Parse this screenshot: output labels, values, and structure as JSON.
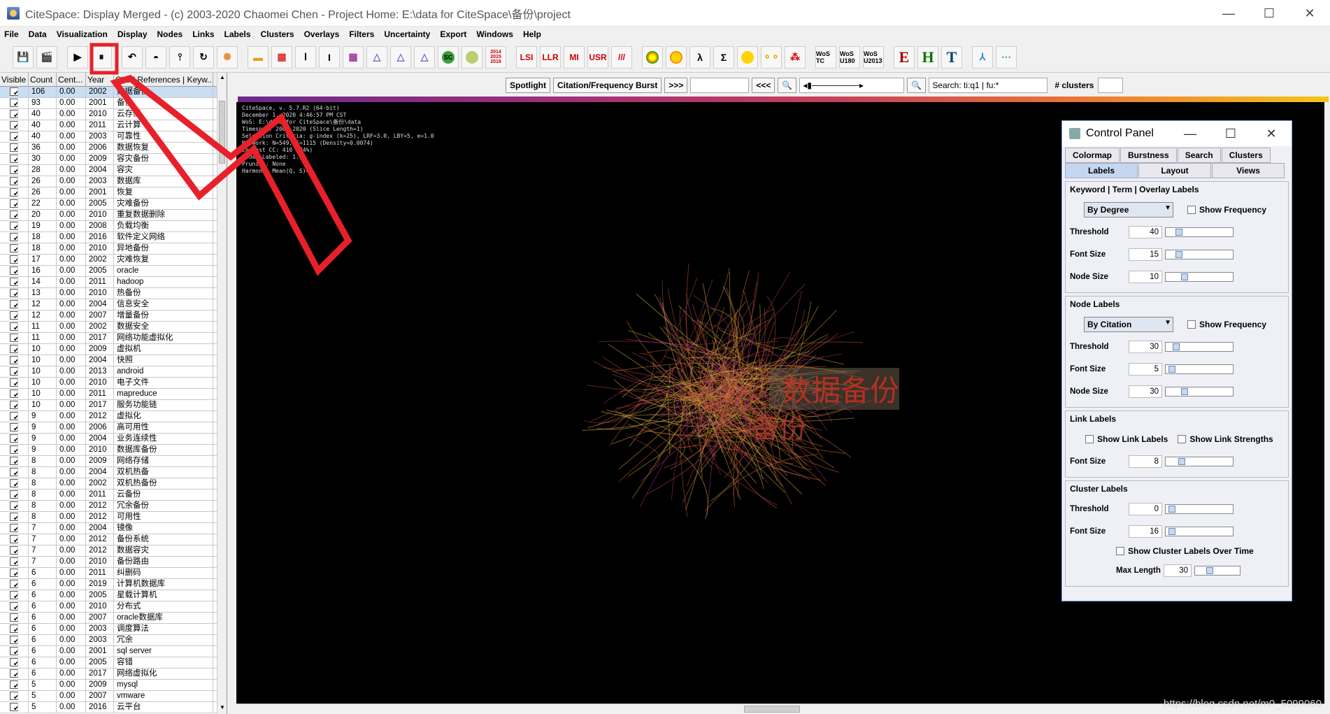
{
  "window": {
    "title": "CiteSpace: Display Merged - (c) 2003-2020 Chaomei Chen - Project Home: E:\\data for CiteSpace\\备份\\project",
    "minimize": "—",
    "maximize": "☐",
    "close": "✕"
  },
  "menu": [
    "File",
    "Data",
    "Visualization",
    "Display",
    "Nodes",
    "Links",
    "Labels",
    "Clusters",
    "Overlays",
    "Filters",
    "Uncertainty",
    "Export",
    "Windows",
    "Help"
  ],
  "toolbar": {
    "years_badge": "2014\n2015\n2016",
    "lsi": "LSI",
    "llr": "LLR",
    "mi": "MI",
    "usr": "USR",
    "slashes": "///",
    "sc": "SC",
    "wos_tc": "WoS TC",
    "wos_u180": "WoS U180",
    "wos_u2013": "WoS U2013",
    "e": "E",
    "h": "H",
    "t": "T"
  },
  "table": {
    "headers": [
      "Visible",
      "Count",
      "Cent...",
      "Year",
      "Cited References | Keyw..."
    ],
    "rows": [
      [
        "106",
        "0.00",
        "2002",
        "数据备份"
      ],
      [
        "93",
        "0.00",
        "2001",
        "备份"
      ],
      [
        "40",
        "0.00",
        "2010",
        "云存储"
      ],
      [
        "40",
        "0.00",
        "2011",
        "云计算"
      ],
      [
        "40",
        "0.00",
        "2003",
        "可靠性"
      ],
      [
        "36",
        "0.00",
        "2006",
        "数据恢复"
      ],
      [
        "30",
        "0.00",
        "2009",
        "容灾备份"
      ],
      [
        "28",
        "0.00",
        "2004",
        "容灾"
      ],
      [
        "26",
        "0.00",
        "2003",
        "数据库"
      ],
      [
        "26",
        "0.00",
        "2001",
        "恢复"
      ],
      [
        "22",
        "0.00",
        "2005",
        "灾难备份"
      ],
      [
        "20",
        "0.00",
        "2010",
        "重复数据删除"
      ],
      [
        "19",
        "0.00",
        "2008",
        "负载均衡"
      ],
      [
        "18",
        "0.00",
        "2016",
        "软件定义网络"
      ],
      [
        "18",
        "0.00",
        "2010",
        "异地备份"
      ],
      [
        "17",
        "0.00",
        "2002",
        "灾难恢复"
      ],
      [
        "16",
        "0.00",
        "2005",
        "oracle"
      ],
      [
        "14",
        "0.00",
        "2011",
        "hadoop"
      ],
      [
        "13",
        "0.00",
        "2010",
        "热备份"
      ],
      [
        "12",
        "0.00",
        "2004",
        "信息安全"
      ],
      [
        "12",
        "0.00",
        "2007",
        "增量备份"
      ],
      [
        "11",
        "0.00",
        "2002",
        "数据安全"
      ],
      [
        "11",
        "0.00",
        "2017",
        "网络功能虚拟化"
      ],
      [
        "10",
        "0.00",
        "2009",
        "虚拟机"
      ],
      [
        "10",
        "0.00",
        "2004",
        "快照"
      ],
      [
        "10",
        "0.00",
        "2013",
        "android"
      ],
      [
        "10",
        "0.00",
        "2010",
        "电子文件"
      ],
      [
        "10",
        "0.00",
        "2011",
        "mapreduce"
      ],
      [
        "10",
        "0.00",
        "2017",
        "服务功能链"
      ],
      [
        "9",
        "0.00",
        "2012",
        "虚拟化"
      ],
      [
        "9",
        "0.00",
        "2006",
        "高可用性"
      ],
      [
        "9",
        "0.00",
        "2004",
        "业务连续性"
      ],
      [
        "9",
        "0.00",
        "2010",
        "数据库备份"
      ],
      [
        "8",
        "0.00",
        "2009",
        "网络存储"
      ],
      [
        "8",
        "0.00",
        "2004",
        "双机热备"
      ],
      [
        "8",
        "0.00",
        "2002",
        "双机热备份"
      ],
      [
        "8",
        "0.00",
        "2011",
        "云备份"
      ],
      [
        "8",
        "0.00",
        "2012",
        "冗余备份"
      ],
      [
        "8",
        "0.00",
        "2012",
        "可用性"
      ],
      [
        "7",
        "0.00",
        "2004",
        "镜像"
      ],
      [
        "7",
        "0.00",
        "2012",
        "备份系统"
      ],
      [
        "7",
        "0.00",
        "2012",
        "数据容灾"
      ],
      [
        "7",
        "0.00",
        "2010",
        "备份路由"
      ],
      [
        "6",
        "0.00",
        "2011",
        "纠删码"
      ],
      [
        "6",
        "0.00",
        "2019",
        "计算机数据库"
      ],
      [
        "6",
        "0.00",
        "2005",
        "星载计算机"
      ],
      [
        "6",
        "0.00",
        "2010",
        "分布式"
      ],
      [
        "6",
        "0.00",
        "2007",
        "oracle数据库"
      ],
      [
        "6",
        "0.00",
        "2003",
        "调度算法"
      ],
      [
        "6",
        "0.00",
        "2003",
        "冗余"
      ],
      [
        "6",
        "0.00",
        "2001",
        "sql server"
      ],
      [
        "6",
        "0.00",
        "2005",
        "容错"
      ],
      [
        "6",
        "0.00",
        "2017",
        "网络虚拟化"
      ],
      [
        "5",
        "0.00",
        "2009",
        "mysql"
      ],
      [
        "5",
        "0.00",
        "2007",
        "vmware"
      ],
      [
        "5",
        "0.00",
        "2016",
        "云平台"
      ]
    ]
  },
  "viz": {
    "spotlight": "Spotlight",
    "burst": "Citation/Frequency Burst",
    "fwd": ">>>",
    "back": "<<<",
    "search": "Search: ti:q1 | fu:*",
    "clusters_label": "# clusters",
    "info": [
      "CiteSpace, v. 5.7.R2 (64-bit)",
      "December 1, 2020 4:46:57 PM CST",
      "WoS: E:\\data for CiteSpace\\备份\\data",
      "Timespan: 2000-2020 (Slice Length=1)",
      "Selection Criteria: g-index (k=25), LRF=3.0, LBY=5, e=1.0",
      "Network: N=549, E=1115 (Density=0.0074)",
      "Largest CC: 410 (74%)",
      "Nodes Labeled: 1.0%",
      "Pruning: None",
      "Harmonic Mean(Q, S)=0"
    ],
    "label1": "数据备份",
    "label2": "备份",
    "watermark": "https://blog.csdn.net/m0_5099060"
  },
  "control_panel": {
    "title": "Control Panel",
    "tabs_row1": [
      "Colormap",
      "Burstness",
      "Search",
      "Clusters"
    ],
    "tabs_row2": [
      "Labels",
      "Layout",
      "Views"
    ],
    "kw": {
      "legend": "Keyword | Term | Overlay Labels",
      "select": "By Degree",
      "show_freq": "Show Frequency",
      "threshold_label": "Threshold",
      "threshold": "40",
      "font_label": "Font Size",
      "font": "15",
      "node_label": "Node Size",
      "node": "10"
    },
    "node": {
      "legend": "Node Labels",
      "select": "By Citation",
      "show_freq": "Show Frequency",
      "threshold_label": "Threshold",
      "threshold": "30",
      "font_label": "Font Size",
      "font": "5",
      "node_label": "Node Size",
      "node": "30"
    },
    "link": {
      "legend": "Link Labels",
      "show_labels": "Show Link Labels",
      "show_strengths": "Show Link Strengths",
      "font_label": "Font Size",
      "font": "8"
    },
    "cluster": {
      "legend": "Cluster Labels",
      "threshold_label": "Threshold",
      "threshold": "0",
      "font_label": "Font Size",
      "font": "16",
      "over_time": "Show Cluster Labels Over Time",
      "max_label": "Max Length",
      "max": "30"
    }
  },
  "colors": {
    "annotation": "#e8202a",
    "canvas": "#000000",
    "accent": "#c5d7f0"
  }
}
